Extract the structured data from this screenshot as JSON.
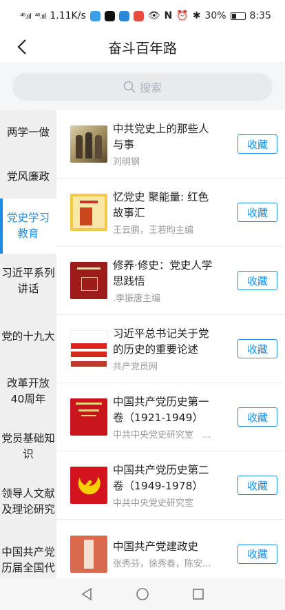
{
  "status_bar": {
    "signal_1": "⁴⁶.ııl",
    "signal_2": "⁴⁶.ııl",
    "net_speed": "1.11K/s",
    "battery": "30%",
    "time": "8:35"
  },
  "header": {
    "title": "奋斗百年路"
  },
  "search": {
    "placeholder": "搜索"
  },
  "sidebar": {
    "items": [
      {
        "label": "两学一做"
      },
      {
        "label": "党风廉政"
      },
      {
        "label": "党史学习教育"
      },
      {
        "label": "习近平系列讲话"
      },
      {
        "label": "党的十九大"
      },
      {
        "label": "改革开放40周年"
      },
      {
        "label": "党员基础知识"
      },
      {
        "label": "领导人文献及理论研究"
      },
      {
        "label": "中国共产党历届全国代"
      }
    ]
  },
  "books": [
    {
      "title": "中共党史上的那些人与事",
      "author": "刘明钢",
      "button": "收藏"
    },
    {
      "title": "忆党史 聚能量: 红色故事汇",
      "author": "王云鹏，王若昀主编",
      "button": "收藏"
    },
    {
      "title": "修养·修史：党史人学思践悟",
      "author": ".李振唐主编",
      "button": "收藏"
    },
    {
      "title": "习近平总书记关于党的历史的重要论述",
      "author": "共产党员网",
      "button": "收藏"
    },
    {
      "title": "中国共产党历史第一卷（1921-1949）",
      "author": "中共中央党史研究室　...",
      "button": "收藏"
    },
    {
      "title": "中国共产党历史第二卷（1949-1978）",
      "author": "中共中央党史研究室",
      "button": "收藏"
    },
    {
      "title": "中国共产党建政史",
      "author": "张秀芬，徐秀春，陈安...",
      "button": "收藏"
    }
  ],
  "colors": {
    "accent": "#1a8ce8",
    "sidebar_bg": "#efefef"
  }
}
